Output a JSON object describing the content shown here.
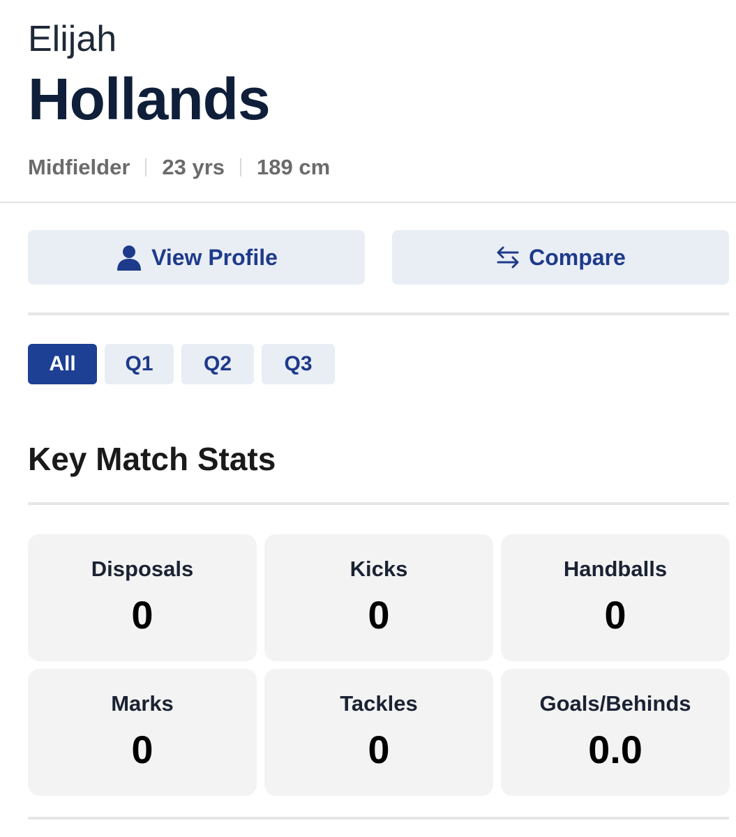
{
  "player": {
    "first_name": "Elijah",
    "last_name": "Hollands",
    "position": "Midfielder",
    "age": "23 yrs",
    "height": "189 cm"
  },
  "actions": {
    "view_profile_label": "View Profile",
    "view_profile_icon": "user-icon",
    "compare_label": "Compare",
    "compare_icon": "swap-arrows-icon"
  },
  "tabs": [
    {
      "label": "All",
      "active": true
    },
    {
      "label": "Q1",
      "active": false
    },
    {
      "label": "Q2",
      "active": false
    },
    {
      "label": "Q3",
      "active": false
    }
  ],
  "stats_section": {
    "title": "Key Match Stats",
    "stats": [
      {
        "label": "Disposals",
        "value": "0"
      },
      {
        "label": "Kicks",
        "value": "0"
      },
      {
        "label": "Handballs",
        "value": "0"
      },
      {
        "label": "Marks",
        "value": "0"
      },
      {
        "label": "Tackles",
        "value": "0"
      },
      {
        "label": "Goals/Behinds",
        "value": "0.0"
      }
    ]
  },
  "colors": {
    "accent": "#1d3f94",
    "button_bg": "#e9eef5",
    "card_bg": "#f3f3f3",
    "name_color": "#0f1f3a"
  }
}
